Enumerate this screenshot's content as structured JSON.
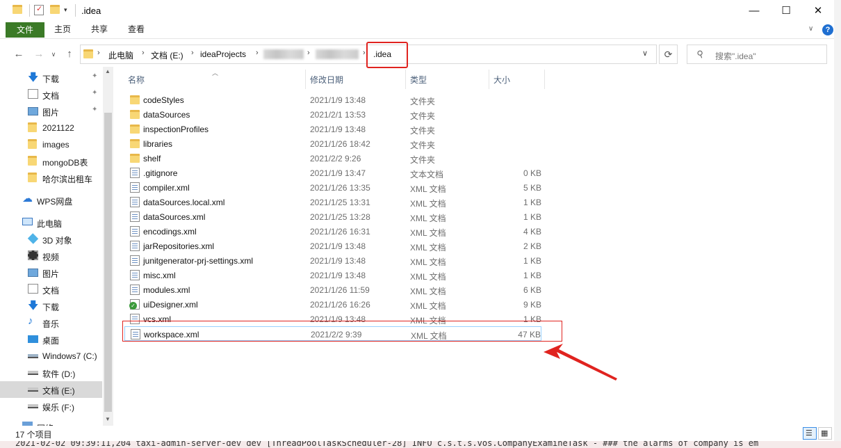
{
  "window": {
    "title": ".idea",
    "controls": {
      "minimize": "—",
      "maximize": "☐",
      "close": "✕"
    }
  },
  "ribbon": {
    "tabs": [
      "文件",
      "主页",
      "共享",
      "查看"
    ]
  },
  "address": {
    "breadcrumbs": [
      "此电脑",
      "文档 (E:)",
      "ideaProjects",
      ".idea"
    ],
    "search_placeholder": "搜索\".idea\""
  },
  "nav_pane": {
    "items": [
      {
        "label": "下载",
        "icon": "download-arrow-icon",
        "pinned": true
      },
      {
        "label": "文档",
        "icon": "document-icon",
        "pinned": true
      },
      {
        "label": "图片",
        "icon": "picture-icon",
        "pinned": true
      },
      {
        "label": "2021122",
        "icon": "folder-icon",
        "pinned": false
      },
      {
        "label": "images",
        "icon": "folder-icon",
        "pinned": false
      },
      {
        "label": "mongoDB表",
        "icon": "folder-icon",
        "pinned": false
      },
      {
        "label": "哈尔滨出租车",
        "icon": "folder-icon",
        "pinned": false
      },
      {
        "label": "WPS网盘",
        "icon": "cloud-icon",
        "pinned": false
      },
      {
        "label": "此电脑",
        "icon": "computer-icon",
        "pinned": false
      },
      {
        "label": "3D 对象",
        "icon": "cube-icon",
        "pinned": false
      },
      {
        "label": "视频",
        "icon": "video-icon",
        "pinned": false
      },
      {
        "label": "图片",
        "icon": "picture-icon",
        "pinned": false
      },
      {
        "label": "文档",
        "icon": "document-icon",
        "pinned": false
      },
      {
        "label": "下载",
        "icon": "download-arrow-icon",
        "pinned": false
      },
      {
        "label": "音乐",
        "icon": "music-note-icon",
        "pinned": false
      },
      {
        "label": "桌面",
        "icon": "desktop-icon",
        "pinned": false
      },
      {
        "label": "Windows7 (C:)",
        "icon": "drive-icon",
        "pinned": false
      },
      {
        "label": "软件 (D:)",
        "icon": "drive-icon",
        "pinned": false
      },
      {
        "label": "文档 (E:)",
        "icon": "drive-icon",
        "pinned": false
      },
      {
        "label": "娱乐 (F:)",
        "icon": "drive-icon",
        "pinned": false
      },
      {
        "label": "网络",
        "icon": "network-icon",
        "pinned": false
      }
    ]
  },
  "file_list": {
    "columns": {
      "name": "名称",
      "date": "修改日期",
      "type": "类型",
      "size": "大小"
    },
    "rows": [
      {
        "name": "codeStyles",
        "date": "2021/1/9 13:48",
        "type": "文件夹",
        "size": "",
        "icon": "folder-icon"
      },
      {
        "name": "dataSources",
        "date": "2021/2/1 13:53",
        "type": "文件夹",
        "size": "",
        "icon": "folder-icon"
      },
      {
        "name": "inspectionProfiles",
        "date": "2021/1/9 13:48",
        "type": "文件夹",
        "size": "",
        "icon": "folder-icon"
      },
      {
        "name": "libraries",
        "date": "2021/1/26 18:42",
        "type": "文件夹",
        "size": "",
        "icon": "folder-icon"
      },
      {
        "name": "shelf",
        "date": "2021/2/2 9:26",
        "type": "文件夹",
        "size": "",
        "icon": "folder-icon"
      },
      {
        "name": ".gitignore",
        "date": "2021/1/9 13:47",
        "type": "文本文档",
        "size": "0 KB",
        "icon": "text-file-icon"
      },
      {
        "name": "compiler.xml",
        "date": "2021/1/26 13:35",
        "type": "XML 文档",
        "size": "5 KB",
        "icon": "xml-file-icon"
      },
      {
        "name": "dataSources.local.xml",
        "date": "2021/1/25 13:31",
        "type": "XML 文档",
        "size": "1 KB",
        "icon": "xml-file-icon"
      },
      {
        "name": "dataSources.xml",
        "date": "2021/1/25 13:28",
        "type": "XML 文档",
        "size": "1 KB",
        "icon": "xml-file-icon"
      },
      {
        "name": "encodings.xml",
        "date": "2021/1/26 16:31",
        "type": "XML 文档",
        "size": "4 KB",
        "icon": "xml-file-icon"
      },
      {
        "name": "jarRepositories.xml",
        "date": "2021/1/9 13:48",
        "type": "XML 文档",
        "size": "2 KB",
        "icon": "xml-file-icon"
      },
      {
        "name": "junitgenerator-prj-settings.xml",
        "date": "2021/1/9 13:48",
        "type": "XML 文档",
        "size": "1 KB",
        "icon": "xml-file-icon"
      },
      {
        "name": "misc.xml",
        "date": "2021/1/9 13:48",
        "type": "XML 文档",
        "size": "1 KB",
        "icon": "xml-file-icon"
      },
      {
        "name": "modules.xml",
        "date": "2021/1/26 11:59",
        "type": "XML 文档",
        "size": "6 KB",
        "icon": "xml-file-icon"
      },
      {
        "name": "uiDesigner.xml",
        "date": "2021/1/26 16:26",
        "type": "XML 文档",
        "size": "9 KB",
        "icon": "xml-checked-file-icon"
      },
      {
        "name": "vcs.xml",
        "date": "2021/1/9 13:48",
        "type": "XML 文档",
        "size": "1 KB",
        "icon": "xml-file-icon"
      },
      {
        "name": "workspace.xml",
        "date": "2021/2/2 9:39",
        "type": "XML 文档",
        "size": "47 KB",
        "icon": "xml-file-icon"
      }
    ]
  },
  "status": {
    "item_count": "17 个项目"
  },
  "background_log": "2021-02-02 09:39:11,204 taxi-admin-server-dev dev [ThreadPoolTaskScheduler-28] INFO c.s.t.s.vos.CompanyExamineTask - ### the alarms of company is em",
  "colors": {
    "accent": "#3b7a27",
    "highlight_red": "#e0231f",
    "selection": "#cce8ff"
  }
}
